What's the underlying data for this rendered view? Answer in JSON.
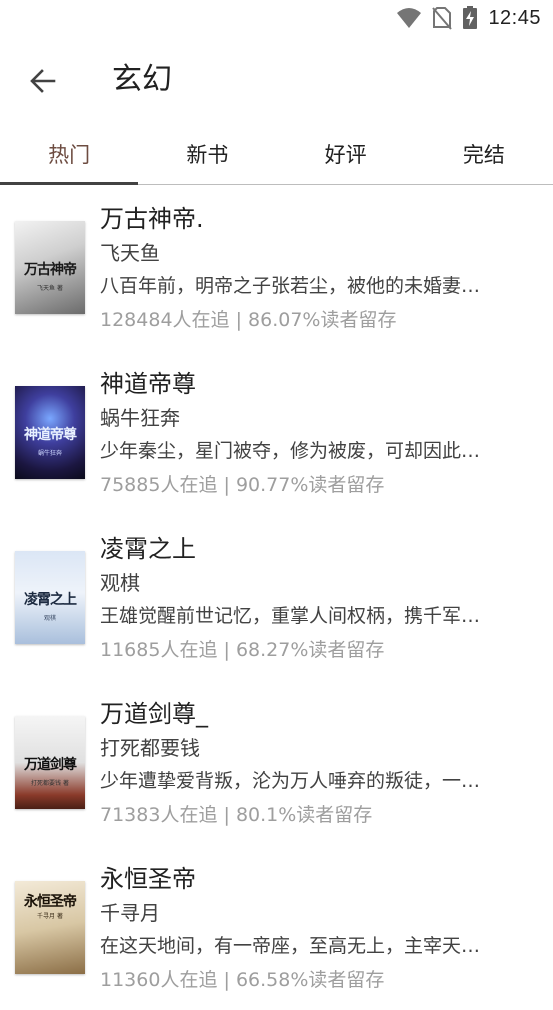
{
  "status_bar": {
    "time": "12:45",
    "icons": [
      "wifi-icon",
      "no-sim-icon",
      "battery-charging-icon"
    ]
  },
  "app_bar": {
    "title": "玄幻",
    "back_icon": "arrow-left-icon"
  },
  "tabs": [
    {
      "label": "热门",
      "active": true
    },
    {
      "label": "新书",
      "active": false
    },
    {
      "label": "好评",
      "active": false
    },
    {
      "label": "完结",
      "active": false
    }
  ],
  "books": [
    {
      "title": "万古神帝.",
      "author": "飞天鱼",
      "description": "八百年前，明帝之子张若尘，被他的未婚妻…",
      "followers": "128484人在追",
      "separator": "|",
      "retention": "86.07%读者留存",
      "cover_text": "万古神帝",
      "cover_sub": "飞天鱼 著"
    },
    {
      "title": "神道帝尊",
      "author": "蜗牛狂奔",
      "description": "少年秦尘，星门被夺，修为被废，可却因此…",
      "followers": "75885人在追",
      "separator": "|",
      "retention": "90.77%读者留存",
      "cover_text": "神道帝尊",
      "cover_sub": "蜗牛狂奔"
    },
    {
      "title": "凌霄之上",
      "author": "观棋",
      "description": "王雄觉醒前世记忆，重掌人间权柄，携千军…",
      "followers": "11685人在追",
      "separator": "|",
      "retention": "68.27%读者留存",
      "cover_text": "凌霄之上",
      "cover_sub": "观棋"
    },
    {
      "title": "万道剑尊_",
      "author": "打死都要钱",
      "description": "少年遭挚爱背叛，沦为万人唾弃的叛徒，一…",
      "followers": "71383人在追",
      "separator": "|",
      "retention": "80.1%读者留存",
      "cover_text": "万道剑尊",
      "cover_sub": "打死都要钱 著"
    },
    {
      "title": "永恒圣帝",
      "author": "千寻月",
      "description": "在这天地间，有一帝座，至高无上，主宰天…",
      "followers": "11360人在追",
      "separator": "|",
      "retention": "66.58%读者留存",
      "cover_text": "永恒圣帝",
      "cover_sub": "千寻月 著"
    }
  ],
  "colors": {
    "active_tab_text": "#6d4c41",
    "indicator": "#424242",
    "stats_text": "#9e9e9e"
  }
}
